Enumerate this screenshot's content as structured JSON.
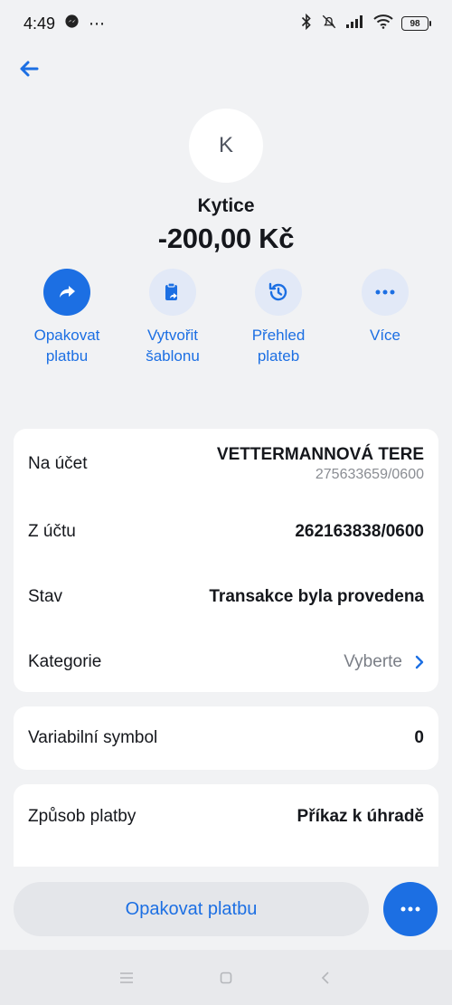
{
  "status_bar": {
    "time": "4:49",
    "battery": "98"
  },
  "header": {
    "avatar_letter": "K",
    "merchant": "Kytice",
    "amount": "-200,00 Kč"
  },
  "actions": [
    {
      "label": "Opakovat\nplatbu",
      "icon": "share-forward-icon"
    },
    {
      "label": "Vytvořit\nšablonu",
      "icon": "clipboard-template-icon"
    },
    {
      "label": "Přehled\nplateb",
      "icon": "history-icon"
    },
    {
      "label": "Více",
      "icon": "more-dots-icon"
    }
  ],
  "details": {
    "to_account_label": "Na účet",
    "to_account_name": "VETTERMANNOVÁ TERE",
    "to_account_number": "275633659/0600",
    "from_account_label": "Z účtu",
    "from_account_number": "262163838/0600",
    "status_label": "Stav",
    "status_value": "Transakce byla provedena",
    "category_label": "Kategorie",
    "category_value": "Vyberte"
  },
  "symbols": {
    "variable_label": "Variabilní symbol",
    "variable_value": "0"
  },
  "payment": {
    "method_label": "Způsob platby",
    "method_value": "Příkaz k úhradě"
  },
  "bottom": {
    "repeat_button": "Opakovat platbu"
  },
  "colors": {
    "accent": "#1c6fe3",
    "background": "#f1f2f4",
    "card": "#ffffff"
  }
}
